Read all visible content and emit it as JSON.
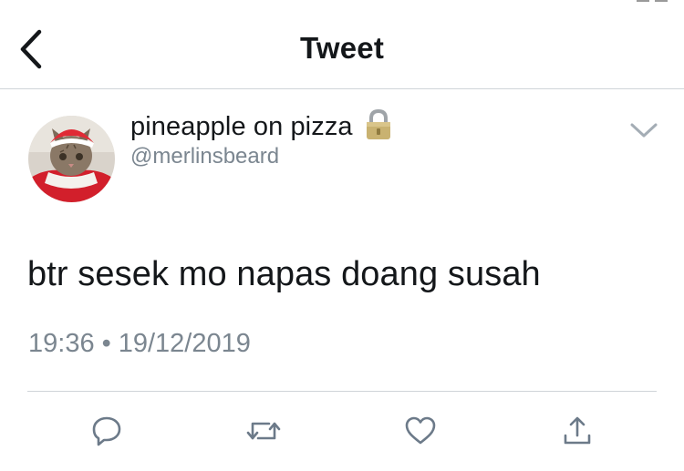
{
  "nav": {
    "title": "Tweet",
    "back_icon": "chevron-left-icon"
  },
  "tweet": {
    "display_name": "pineapple on pizza",
    "username": "@merlinsbeard",
    "protected_icon": "lock-icon",
    "menu_icon": "chevron-down-icon",
    "text": "btr sesek mo napas doang susah",
    "time": "19:36",
    "separator": "•",
    "date": "19/12/2019"
  },
  "actions": [
    {
      "name": "reply",
      "icon": "reply-icon"
    },
    {
      "name": "retweet",
      "icon": "retweet-icon"
    },
    {
      "name": "like",
      "icon": "heart-icon"
    },
    {
      "name": "share",
      "icon": "share-icon"
    }
  ],
  "colors": {
    "text": "#14171a",
    "secondary": "#7b8690",
    "divider": "#cfd4d8",
    "action_icon": "#6c7a89",
    "lock_gold": "#c9b271"
  }
}
